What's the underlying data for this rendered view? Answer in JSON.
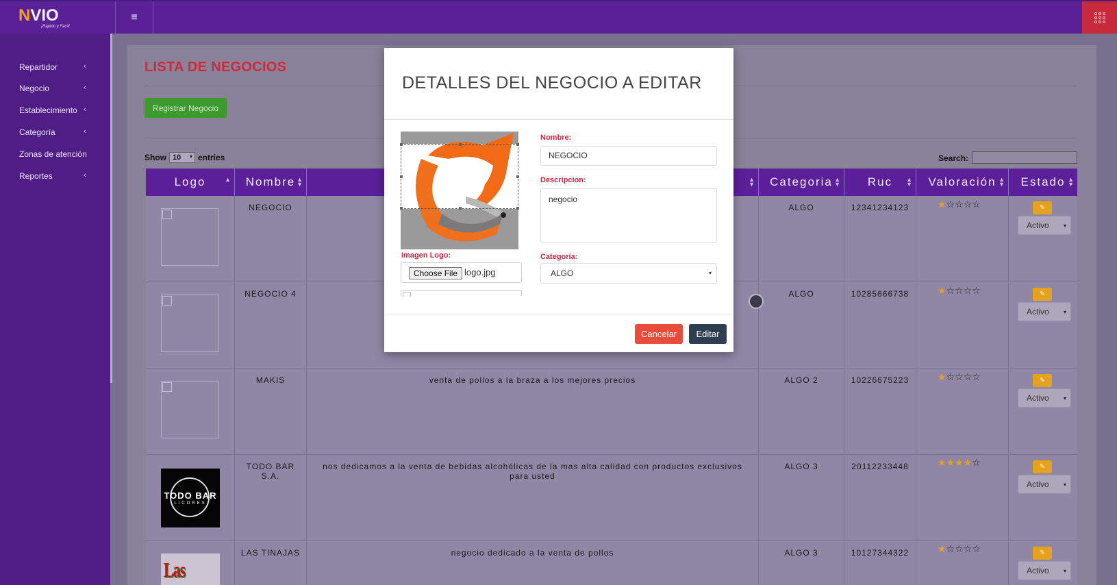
{
  "brand": {
    "name_initial": "N",
    "name_rest": "VIO",
    "tagline": "¡Rápido y Fácil!"
  },
  "topbar": {
    "menu_glyph": "≡"
  },
  "sidebar": {
    "items": [
      {
        "label": "Repartidor",
        "has_submenu": true
      },
      {
        "label": "Negocio",
        "has_submenu": true
      },
      {
        "label": "Establecimiento",
        "has_submenu": true
      },
      {
        "label": "Categoría",
        "has_submenu": true
      },
      {
        "label": "Zonas de atención",
        "has_submenu": false
      },
      {
        "label": "Reportes",
        "has_submenu": true
      }
    ],
    "chevron": "‹"
  },
  "page": {
    "title": "LISTA DE NEGOCIOS",
    "register_button": "Registrar Negocio",
    "show_label": "Show",
    "show_value": "10",
    "entries_label": "entries",
    "search_label": "Search:"
  },
  "table": {
    "columns": [
      "Logo",
      "Nombre",
      "",
      "Categoria",
      "Ruc",
      "Valoración",
      "Estado"
    ],
    "rows": [
      {
        "nombre": "NEGOCIO",
        "descripcion": "",
        "categoria": "ALGO",
        "ruc": "12341234123",
        "rating": 1,
        "estado": "Activo"
      },
      {
        "nombre": "NEGOCIO 4",
        "descripcion": "",
        "categoria": "ALGO",
        "ruc": "10285666738",
        "rating": 1,
        "estado": "Activo"
      },
      {
        "nombre": "MAKIS",
        "descripcion": "venta de pollos a la braza a los mejores precios",
        "categoria": "ALGO 2",
        "ruc": "10226675223",
        "rating": 1,
        "estado": "Activo"
      },
      {
        "nombre": "TODO BAR S.A.",
        "descripcion": "nos dedicamos a la venta de bebidas alcohólicas de la mas alta calidad con productos exclusivos para usted",
        "categoria": "ALGO 3",
        "ruc": "20112233448",
        "rating": 4,
        "estado": "Activo"
      },
      {
        "nombre": "LAS TINAJAS",
        "descripcion": "negocio dedicado a la venta de pollos",
        "categoria": "ALGO 3",
        "ruc": "10127344322",
        "rating": 1,
        "estado": "Activo"
      }
    ],
    "todobar_logo": {
      "line1": "TODO BAR",
      "line2": "LICORES"
    },
    "tinajas_logo": "Las Tinajas",
    "star_filled": "★",
    "star_empty": "☆",
    "edit_icon_glyph": "✎",
    "caret": "▾"
  },
  "modal": {
    "title": "DETALLES DEL NEGOCIO A EDITAR",
    "image_label": "Imagen Logo:",
    "file_button": "Choose File",
    "file_name": "logo.jpg",
    "nombre_label": "Nombre:",
    "nombre_value": "NEGOCIO",
    "descripcion_label": "Descripcion:",
    "descripcion_value": "negocio",
    "categoria_label": "Categoría:",
    "categoria_value": "ALGO",
    "cancel_button": "Cancelar",
    "edit_button": "Editar"
  },
  "colors": {
    "topbar": "#5a2196",
    "sidebar": "#4f1e84",
    "accent_red": "#cc2b3d",
    "register_green": "#3c9a2e",
    "edit_orange": "#e6a21e",
    "cancel_red": "#e74c3c",
    "edit_navy": "#2c3e50"
  }
}
